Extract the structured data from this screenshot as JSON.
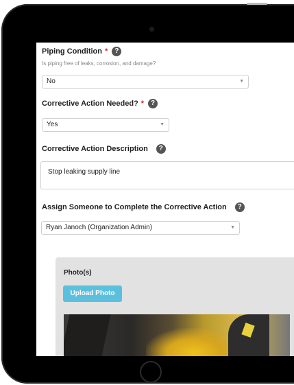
{
  "form": {
    "piping": {
      "label": "Piping Condition",
      "required_mark": "*",
      "help": "?",
      "subtext": "Is piping free of leaks, corrosion, and damage?",
      "value": "No"
    },
    "corrective_needed": {
      "label": "Corrective Action Needed?",
      "required_mark": "*",
      "help": "?",
      "value": "Yes"
    },
    "corrective_desc": {
      "label": "Corrective Action Description",
      "help": "?",
      "value": "Stop leaking supply line"
    },
    "assign": {
      "label": "Assign Someone to Complete the Corrective Action",
      "help": "?",
      "value": "Ryan Janoch (Organization Admin)"
    },
    "photos": {
      "title": "Photo(s)",
      "upload_label": "Upload Photo"
    }
  },
  "icons": {
    "dropdown": "chevron-down-icon",
    "help": "question-circle-icon"
  }
}
